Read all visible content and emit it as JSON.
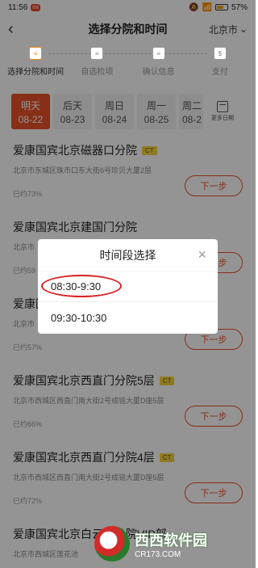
{
  "status_bar": {
    "time": "11:56",
    "battery": "57%"
  },
  "header": {
    "title": "选择分院和时间",
    "city": "北京市"
  },
  "steps": [
    {
      "label": "选择分院和时间",
      "active": true
    },
    {
      "label": "自选检项",
      "active": false
    },
    {
      "label": "确认信息",
      "active": false
    },
    {
      "label": "支付",
      "active": false
    }
  ],
  "dates": [
    {
      "day": "明天",
      "date": "08-22",
      "selected": true
    },
    {
      "day": "后天",
      "date": "08-23",
      "selected": false
    },
    {
      "day": "周日",
      "date": "08-24",
      "selected": false
    },
    {
      "day": "周一",
      "date": "08-25",
      "selected": false
    },
    {
      "day": "周二",
      "date": "08-2",
      "selected": false
    }
  ],
  "more_dates_label": "更多日期",
  "branches": [
    {
      "name": "爱康国宾北京磁器口分院",
      "badge": "CT",
      "address": "北京市东城区珠市口东大街6号珍贝大厦2层",
      "rate": "已约73%",
      "button": "下一步"
    },
    {
      "name": "爱康国宾北京建国门分院",
      "badge": "",
      "address": "北京市",
      "rate": "已约59",
      "button": "下一步"
    },
    {
      "name": "爱康国宾北京",
      "badge": "",
      "address": "北京市",
      "rate": "已约57%",
      "button": "下一步"
    },
    {
      "name": "爱康国宾北京西直门分院5层",
      "badge": "CT",
      "address": "北京市西城区西直门南大街2号成铭大厦D座5层",
      "rate": "已约66%",
      "button": "下一步"
    },
    {
      "name": "爱康国宾北京西直门分院4层",
      "badge": "CT",
      "address": "北京市西城区西直门南大街2号成铭大厦D座5层",
      "rate": "已约72%",
      "button": "下一步"
    },
    {
      "name": "爱康国宾北京白云路分院VIP部",
      "badge": "",
      "address": "北京市西城区莲花池",
      "rate": "",
      "button": ""
    }
  ],
  "modal": {
    "title": "时间段选择",
    "close_icon": "close-icon",
    "slots": [
      "08:30-9:30",
      "09:30-10:30"
    ],
    "highlighted_slot": 0
  },
  "watermark": {
    "title": "西西软件园",
    "url": "CR173.COM"
  }
}
